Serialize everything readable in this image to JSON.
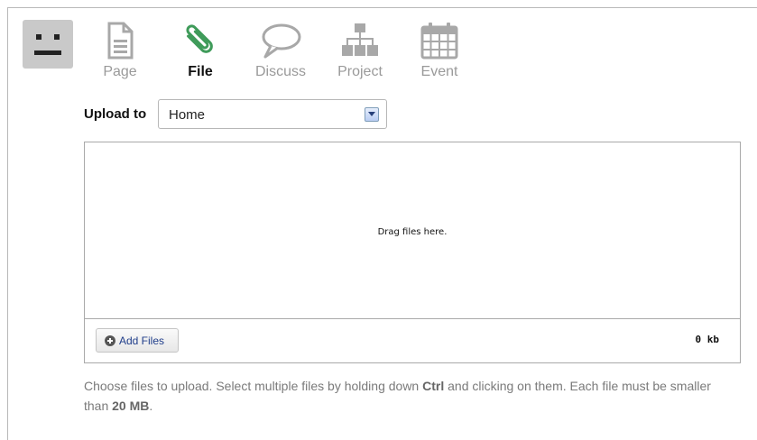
{
  "toolbar": {
    "tabs": [
      {
        "label": "Page",
        "icon": "page-icon"
      },
      {
        "label": "File",
        "icon": "paperclip-icon",
        "active": true
      },
      {
        "label": "Discuss",
        "icon": "speech-bubble-icon"
      },
      {
        "label": "Project",
        "icon": "hierarchy-icon"
      },
      {
        "label": "Event",
        "icon": "calendar-icon"
      }
    ]
  },
  "upload": {
    "label": "Upload to",
    "destination": "Home"
  },
  "dropzone": {
    "text": "Drag files here.",
    "add_files_label": "Add Files",
    "total_size": "0 kb"
  },
  "help": {
    "part1": "Choose files to upload. Select multiple files by holding down ",
    "key": "Ctrl",
    "part2": " and clicking on them. Each file must be smaller than ",
    "limit": "20 MB",
    "part3": "."
  },
  "colors": {
    "file_icon": "#3f9b5a",
    "inactive_icon": "#a8a8a8",
    "inactive_label": "#9a9a9a"
  }
}
